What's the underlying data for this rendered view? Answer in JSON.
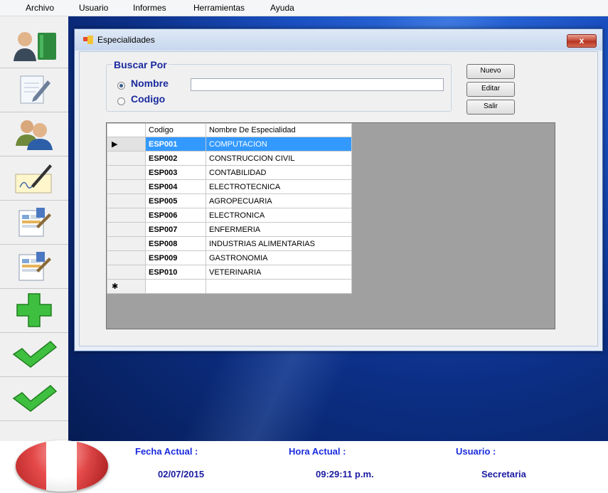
{
  "menubar": {
    "items": [
      "Archivo",
      "Usuario",
      "Informes",
      "Herramientas",
      "Ayuda"
    ]
  },
  "sidebar": {
    "buttons": [
      "users-book-icon",
      "notepad-edit-icon",
      "users-group-icon",
      "signature-pen-icon",
      "spreadsheet-report-icon",
      "spreadsheet-report-icon",
      "green-plus-icon",
      "green-check-icon",
      "green-check-icon"
    ]
  },
  "window": {
    "title": "Especialidades",
    "close_label": "x",
    "search_group": {
      "legend": "Buscar Por",
      "option_name": "Nombre",
      "option_code": "Codigo",
      "selected": "Nombre",
      "search_value": ""
    },
    "buttons": {
      "new": "Nuevo",
      "edit": "Editar",
      "exit": "Salir"
    },
    "grid": {
      "columns": [
        "Codigo",
        "Nombre De Especialidad"
      ],
      "row_selector_marker": "▶",
      "new_row_marker": "✱",
      "selected_row": 0,
      "rows": [
        {
          "code": "ESP001",
          "name": "COMPUTACION"
        },
        {
          "code": "ESP002",
          "name": "CONSTRUCCION CIVIL"
        },
        {
          "code": "ESP003",
          "name": "CONTABILIDAD"
        },
        {
          "code": "ESP004",
          "name": "ELECTROTECNICA"
        },
        {
          "code": "ESP005",
          "name": "AGROPECUARIA"
        },
        {
          "code": "ESP006",
          "name": "ELECTRONICA"
        },
        {
          "code": "ESP007",
          "name": "ENFERMERIA"
        },
        {
          "code": "ESP008",
          "name": "INDUSTRIAS ALIMENTARIAS"
        },
        {
          "code": "ESP009",
          "name": "GASTRONOMIA"
        },
        {
          "code": "ESP010",
          "name": "VETERINARIA"
        }
      ]
    }
  },
  "statusbar": {
    "date_label": "Fecha Actual :",
    "date_value": "02/07/2015",
    "time_label": "Hora Actual :",
    "time_value": "09:29:11 p.m.",
    "user_label": "Usuario :",
    "user_value": "Secretaria"
  },
  "colors": {
    "label_blue": "#1a2a9e",
    "selection": "#3399ff",
    "desktop": "#1a4fc0"
  }
}
